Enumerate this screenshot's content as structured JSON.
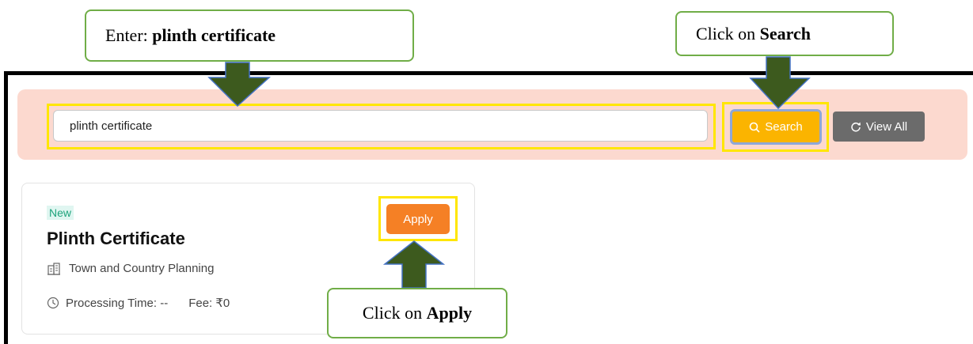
{
  "callouts": {
    "enter_prefix": "Enter: ",
    "enter_bold": "plinth certificate",
    "search_prefix": "Click on ",
    "search_bold": "Search",
    "apply_prefix": "Click on ",
    "apply_bold": "Apply"
  },
  "search": {
    "value": "plinth certificate",
    "button_label": "Search",
    "view_all_label": "View All"
  },
  "card": {
    "badge": "New",
    "title": "Plinth Certificate",
    "department": "Town and Country Planning",
    "processing_label": "Processing Time: --",
    "fee_label": "Fee: ₹0",
    "apply_label": "Apply"
  },
  "colors": {
    "callout_border": "#70ad47",
    "highlight": "#ffe600",
    "arrow": "#3d5a1e",
    "search_bar_bg": "#fcd9cf",
    "search_button": "#fbb400",
    "apply_button": "#f58025",
    "view_all_button": "#6b6b6b"
  },
  "icons": [
    "search-icon",
    "refresh-icon",
    "building-icon",
    "clock-icon",
    "arrow-down-icon",
    "arrow-up-icon"
  ]
}
